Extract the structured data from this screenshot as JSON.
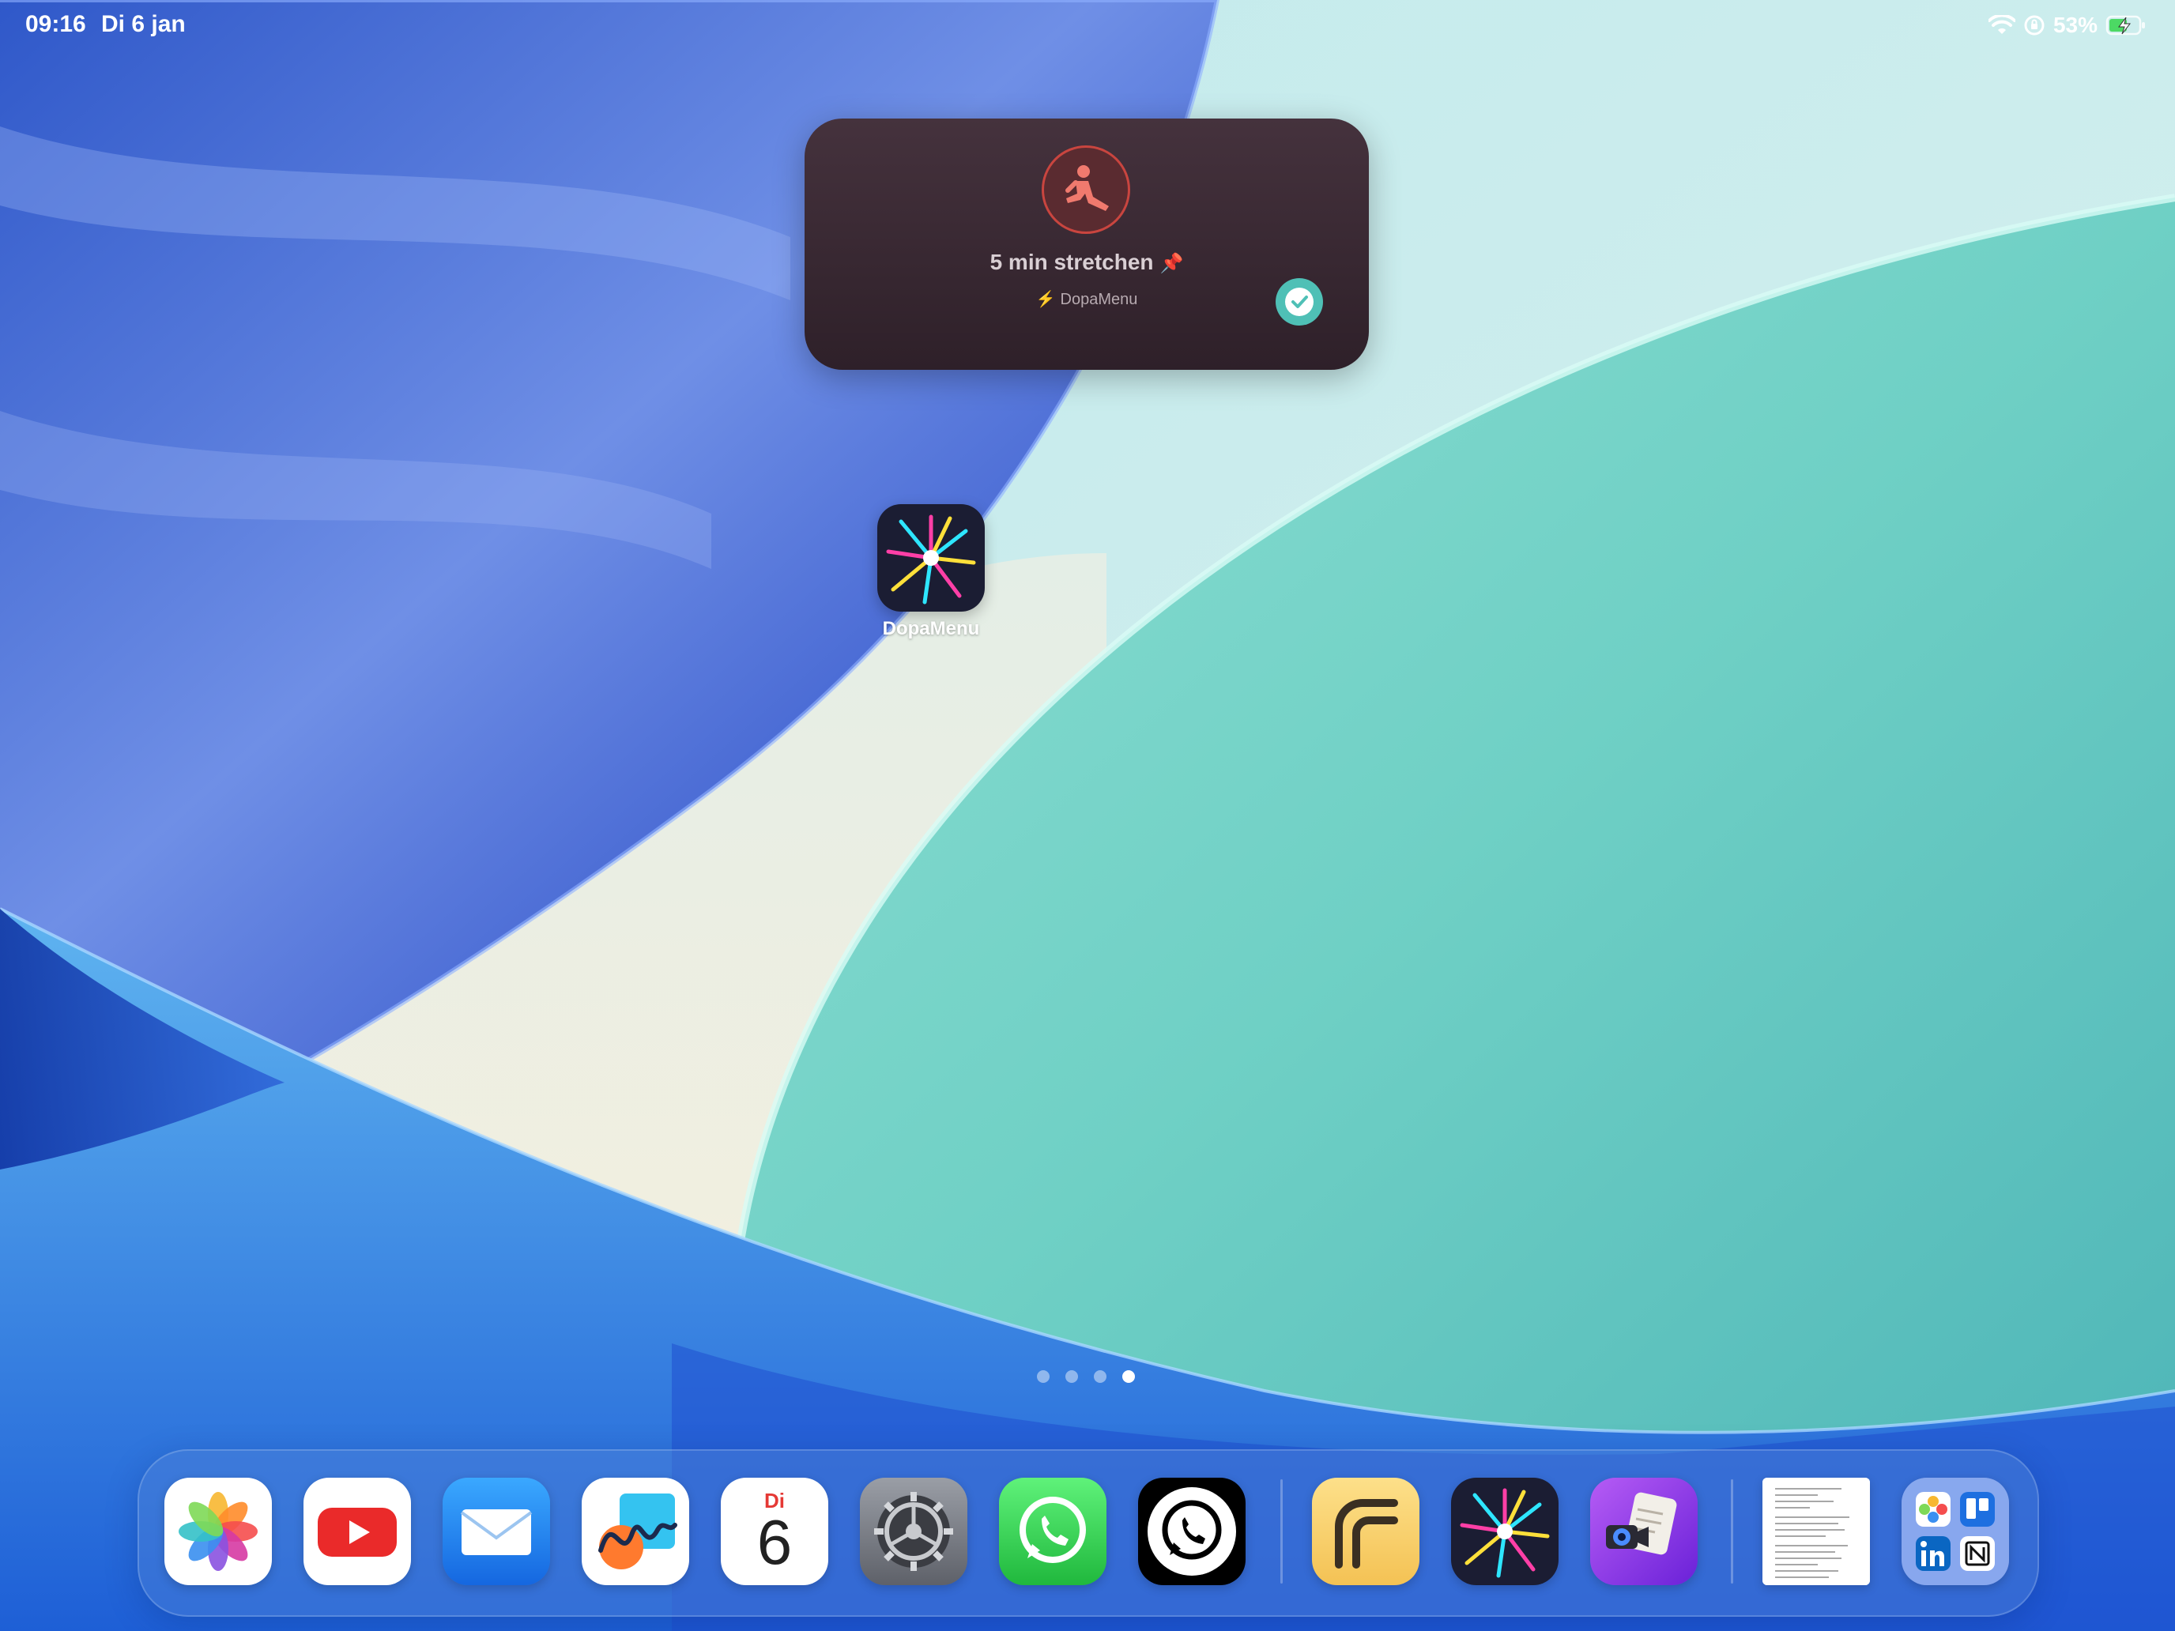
{
  "status_bar": {
    "time": "09:16",
    "date": "Di 6 jan",
    "battery_percent": "53%",
    "icons": [
      "wifi-icon",
      "orientation-lock-icon",
      "battery-charging-icon"
    ]
  },
  "widget": {
    "title": "5 min stretchen",
    "pin_glyph": "📌",
    "source_app": "DopaMenu",
    "icon": "stretching-person-icon",
    "action_icon": "checkmark-icon",
    "accent_color": "#e4574f",
    "check_color": "#4fc0b6"
  },
  "home_screen": {
    "apps": [
      {
        "label": "DopaMenu",
        "icon": "dopamenu-icon"
      }
    ],
    "page_dots": {
      "count": 4,
      "active_index": 3
    }
  },
  "dock": {
    "apps": [
      {
        "icon": "photos-icon"
      },
      {
        "icon": "youtube-icon"
      },
      {
        "icon": "mail-icon"
      },
      {
        "icon": "freeform-icon"
      },
      {
        "icon": "calendar-icon",
        "day": "Di",
        "date": "6"
      },
      {
        "icon": "settings-icon"
      },
      {
        "icon": "whatsapp-business-icon"
      },
      {
        "icon": "whatsapp-icon"
      }
    ],
    "recents": [
      {
        "icon": "reeder-icon"
      },
      {
        "icon": "dopamenu-icon"
      },
      {
        "icon": "script-camera-icon"
      }
    ],
    "extras": [
      {
        "icon": "document-thumbnail-icon"
      },
      {
        "icon": "app-folder-icon",
        "contents": [
          "photos-icon",
          "trello-icon",
          "linkedin-icon",
          "notion-icon"
        ]
      }
    ]
  }
}
